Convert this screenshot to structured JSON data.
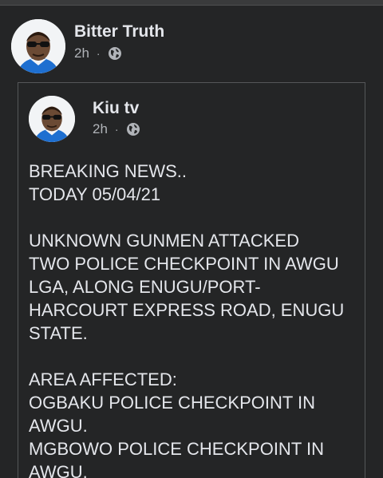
{
  "sharer": {
    "name": "Bitter Truth",
    "time": "2h",
    "separator": "·",
    "privacy_icon": "globe-icon"
  },
  "original_post": {
    "author": "Kiu tv",
    "time": "2h",
    "separator": "·",
    "privacy_icon": "globe-icon",
    "lines": [
      "BREAKING NEWS..",
      "TODAY 05/04/21",
      "",
      "UNKNOWN GUNMEN ATTACKED",
      "TWO POLICE CHECKPOINT IN AWGU",
      "LGA, ALONG ENUGU/PORT-",
      "HARCOURT EXPRESS ROAD, ENUGU",
      "STATE.",
      "",
      "AREA AFFECTED:",
      "OGBAKU POLICE CHECKPOINT IN",
      "AWGU.",
      "MGBOWO POLICE CHECKPOINT IN",
      "AWGU."
    ]
  },
  "colors": {
    "background": "#242526",
    "primary_text": "#e4e6eb",
    "secondary_text": "#b0b3b8",
    "border": "#555759"
  }
}
